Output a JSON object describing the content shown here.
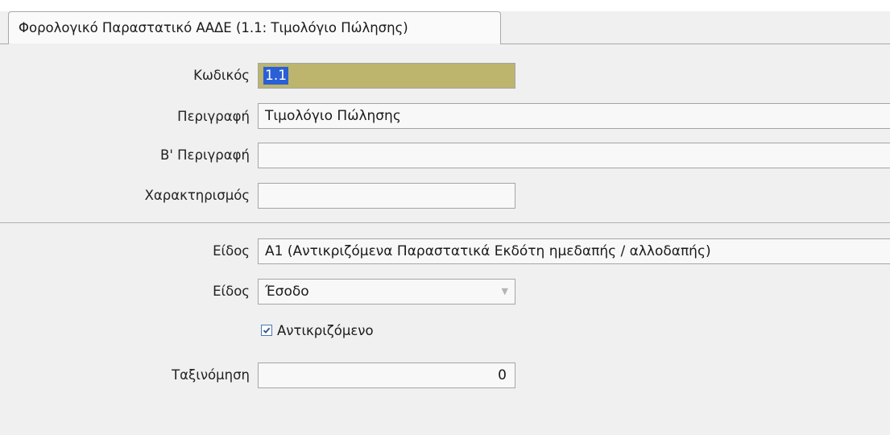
{
  "tab": {
    "label": "Φορολογικό Παραστατικό ΑΑΔΕ  (1.1: Τιμολόγιο Πώλησης)"
  },
  "form": {
    "code": {
      "label": "Κωδικός",
      "value": "1.1"
    },
    "description": {
      "label": "Περιγραφή",
      "value": "Τιμολόγιο Πώλησης"
    },
    "description_b": {
      "label": "Β' Περιγραφή",
      "value": ""
    },
    "characterization": {
      "label": "Χαρακτηρισμός",
      "value": ""
    },
    "type": {
      "label": "Είδος",
      "value": "A1 (Αντικριζόμενα Παραστατικά Εκδότη ημεδαπής / αλλοδαπής)"
    },
    "kind": {
      "label": "Είδος",
      "value": "Έσοδο"
    },
    "countered": {
      "label": "Αντικριζόμενο",
      "checked": true
    },
    "sort_order": {
      "label": "Ταξινόμηση",
      "value": "0"
    }
  },
  "colors": {
    "code_field_bg": "#bdb56e",
    "selection": "#2a5fd6",
    "background": "#f0f0f0"
  },
  "icons": {
    "combo": "chevron-down-icon",
    "check": "checkmark-icon"
  }
}
